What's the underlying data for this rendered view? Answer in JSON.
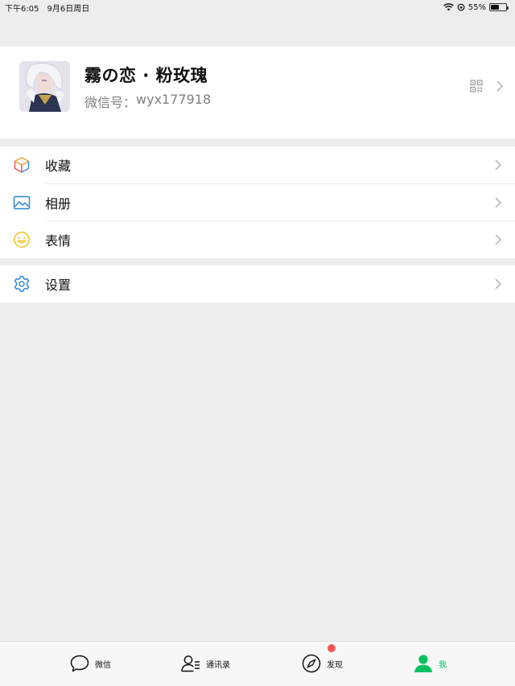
{
  "status_bar": {
    "time": "下午6:05",
    "date": "9月6日周日",
    "battery": "55%",
    "battery_level": 0.55
  },
  "profile": {
    "nickname": "霧の恋 · 粉玫瑰",
    "wechat_id_label": "微信号：",
    "wechat_id": "wyx177918"
  },
  "menu": {
    "favorites": "收藏",
    "album": "相册",
    "stickers": "表情",
    "settings": "设置"
  },
  "tabbar": {
    "chats": "微信",
    "contacts": "通讯录",
    "discover": "发现",
    "me": "我"
  },
  "colors": {
    "accent": "#07c160",
    "badge": "#f25555",
    "background": "#ededed"
  }
}
